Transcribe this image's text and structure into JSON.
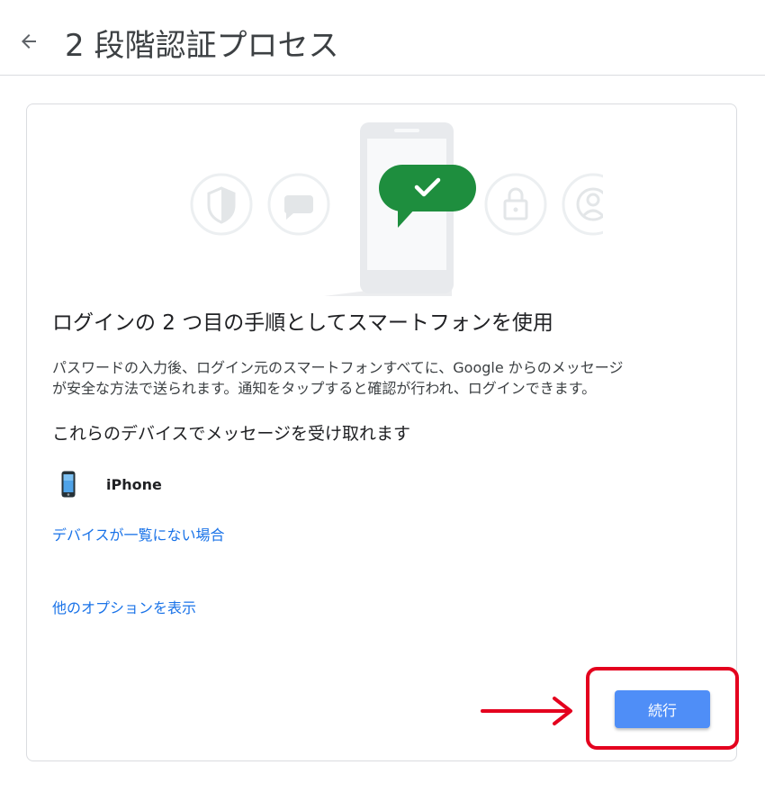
{
  "header": {
    "back_icon": "arrow-back-icon",
    "title": "2 段階認証プロセス"
  },
  "illustration": {
    "icons": [
      "shield-icon",
      "chat-bubble-icon",
      "phone-icon",
      "checkmark-icon",
      "lock-icon",
      "account-icon"
    ],
    "colors": {
      "bubble": "#1e8e3e",
      "phone_body": "#e8eaed",
      "screen": "#f8f9fa",
      "faint_icons": "#eceff1"
    }
  },
  "content": {
    "headline": "ログインの 2 つ目の手順としてスマートフォンを使用",
    "description_lines": [
      "パスワードの入力後、ログイン元のスマートフォンすべてに、Google からのメッセージ",
      "が安全な方法で送られます。通知をタップすると確認が行われ、ログインできます。"
    ],
    "devices_heading": "これらのデバイスでメッセージを受け取れます",
    "devices": [
      {
        "name": "iPhone",
        "icon": "smartphone-icon"
      }
    ],
    "link_missing_device": "デバイスが一覧にない場合",
    "link_more_options": "他のオプションを表示"
  },
  "actions": {
    "continue_label": "続行",
    "accent_color": "#4f8ef7"
  },
  "annotation": {
    "highlight_color": "#e4001e",
    "arrow_icon": "arrow-right-icon"
  }
}
